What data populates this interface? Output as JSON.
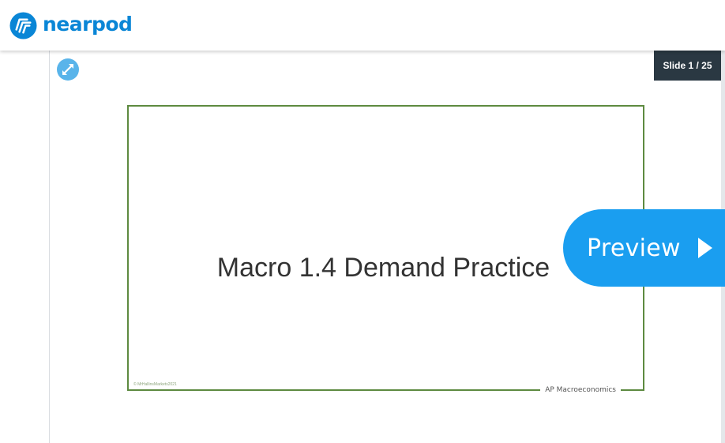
{
  "app": {
    "brand_name": "nearpod",
    "brand_color": "#0a86d6"
  },
  "toolbar": {
    "expand_icon": "expand-arrows-icon",
    "slide_counter": "Slide 1 / 25"
  },
  "slide": {
    "title": "Macro 1.4 Demand Practice",
    "copyright": "© MrHallinsMarkets2021",
    "footer": "AP Macroeconomics",
    "border_color": "#5d8a40"
  },
  "preview": {
    "label": "Preview",
    "icon": "play-triangle-icon",
    "color": "#1a9ef0"
  }
}
